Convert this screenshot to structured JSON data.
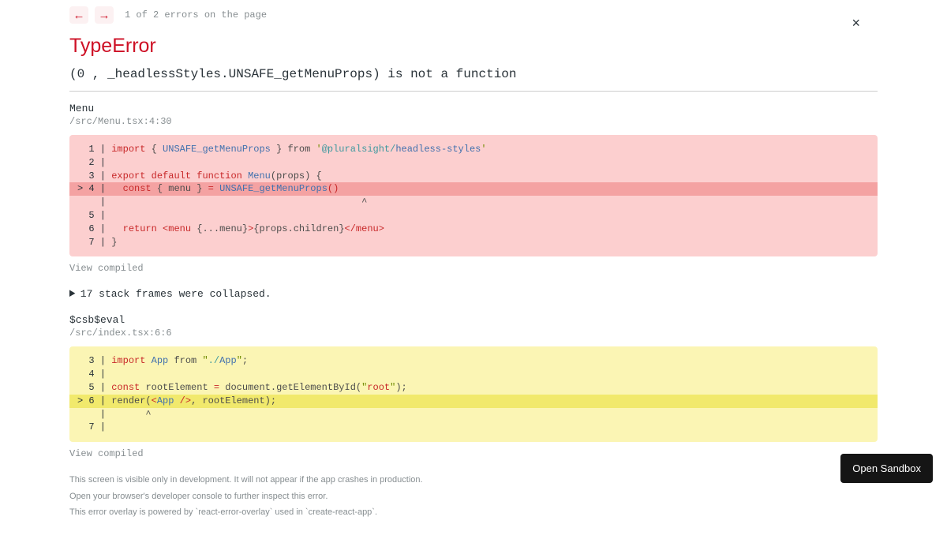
{
  "pager": {
    "text": "1 of 2 errors on the page"
  },
  "close_label": "×",
  "error": {
    "type": "TypeError",
    "message": "(0 , _headlessStyles.UNSAFE_getMenuProps) is not a function"
  },
  "frame1": {
    "func": "Menu",
    "loc": "/src/Menu.tsx:4:30",
    "view_compiled": "View compiled"
  },
  "collapsed_text": "17 stack frames were collapsed.",
  "frame2": {
    "func": "$csb$eval",
    "loc": "/src/index.tsx:6:6",
    "view_compiled": "View compiled"
  },
  "code1": {
    "l1_a": "import",
    "l1_b": "UNSAFE_getMenuProps",
    "l1_c": "from",
    "l1_d": "'",
    "l1_e": "@pluralsight",
    "l1_f": "/",
    "l1_g": "headless-styles",
    "l1_h": "'",
    "l3_a": "export",
    "l3_b": "default",
    "l3_c": "function",
    "l3_d": "Menu",
    "l3_e": "(props)",
    "l3_f": "{",
    "l4_a": "const",
    "l4_b": "{",
    "l4_c": "menu",
    "l4_d": "}",
    "l4_e": "=",
    "l4_f": "UNSAFE_getMenuProps",
    "l4_g": "(",
    "l4_h": ")",
    "l4_caret": "                                            ^",
    "l6_a": "return",
    "l6_b": "<",
    "l6_c": "menu",
    "l6_d": "{",
    "l6_e": "...menu",
    "l6_f": "}",
    "l6_g": ">",
    "l6_h": "{props.children}",
    "l6_i": "</",
    "l6_j": "menu",
    "l6_k": ">",
    "l7_a": "}"
  },
  "code2": {
    "l3_a": "import",
    "l3_b": "App",
    "l3_c": "from",
    "l3_d": "\"",
    "l3_e": "./",
    "l3_f": "App",
    "l3_g": "\"",
    "l3_h": ";",
    "l5_a": "const",
    "l5_b": "rootElement",
    "l5_c": "=",
    "l5_d": "document.getElementById(",
    "l5_e": "\"",
    "l5_f": "root",
    "l5_g": "\"",
    "l5_h": ");",
    "l6_a": "render(",
    "l6_b": "<",
    "l6_c": "App",
    "l6_d": "/>",
    "l6_e": ", rootElement);",
    "l6_caret": "      ^"
  },
  "gutters": {
    "c1_1": "  1 | ",
    "c1_2": "  2 | ",
    "c1_3": "  3 | ",
    "c1_4": "> 4 | ",
    "c1_4b": "    | ",
    "c1_5": "  5 | ",
    "c1_6": "  6 | ",
    "c1_7": "  7 | ",
    "c2_3": "  3 | ",
    "c2_4": "  4 | ",
    "c2_5": "  5 | ",
    "c2_6": "> 6 | ",
    "c2_6b": "    | ",
    "c2_7": "  7 | "
  },
  "footer": {
    "l1": "This screen is visible only in development. It will not appear if the app crashes in production.",
    "l2": "Open your browser's developer console to further inspect this error.",
    "l3": "This error overlay is powered by `react-error-overlay` used in `create-react-app`."
  },
  "sandbox_label": "Open Sandbox"
}
